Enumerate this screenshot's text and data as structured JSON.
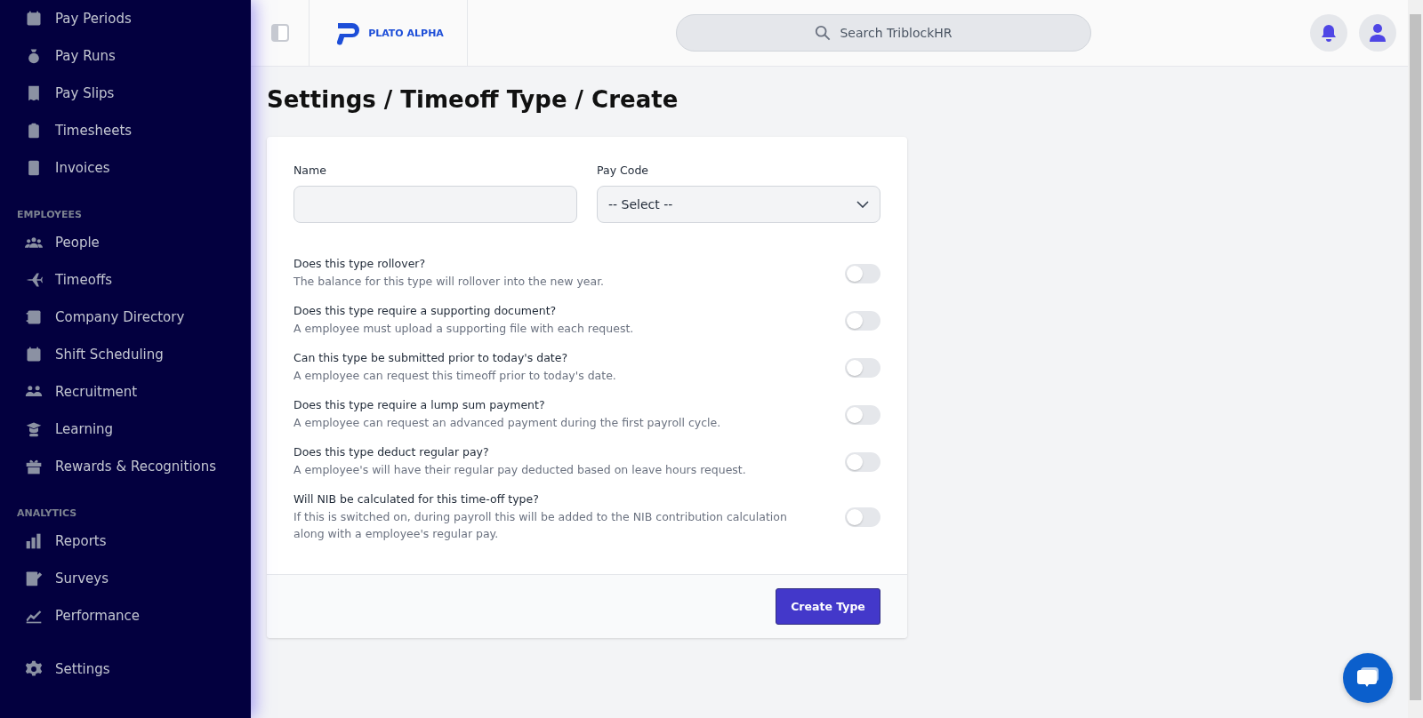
{
  "sidebar": {
    "groups": [
      {
        "items": [
          {
            "label": "Pay Periods"
          },
          {
            "label": "Pay Runs"
          },
          {
            "label": "Pay Slips"
          },
          {
            "label": "Timesheets"
          },
          {
            "label": "Invoices"
          }
        ]
      },
      {
        "heading": "EMPLOYEES",
        "items": [
          {
            "label": "People"
          },
          {
            "label": "Timeoffs"
          },
          {
            "label": "Company Directory"
          },
          {
            "label": "Shift Scheduling"
          },
          {
            "label": "Recruitment"
          },
          {
            "label": "Learning"
          },
          {
            "label": "Rewards & Recognitions"
          }
        ]
      },
      {
        "heading": "ANALYTICS",
        "items": [
          {
            "label": "Reports"
          },
          {
            "label": "Surveys"
          },
          {
            "label": "Performance"
          }
        ]
      }
    ],
    "footer_item": {
      "label": "Settings"
    }
  },
  "header": {
    "logo_text": "PLATO ALPHA",
    "search": {
      "placeholder": "Search TriblockHR"
    }
  },
  "page_title": "Settings / Timeoff Type / Create",
  "form": {
    "name_field": {
      "label": "Name"
    },
    "pay_code": {
      "label": "Pay Code",
      "value": "-- Select --"
    },
    "toggles": [
      {
        "question": "Does this type rollover?",
        "description": "The balance for this type will rollover into the new year.",
        "on": false
      },
      {
        "question": "Does this type require a supporting document?",
        "description": "A employee must upload a supporting file with each request.",
        "on": false
      },
      {
        "question": "Can this type be submitted prior to today's date?",
        "description": "A employee can request this timeoff prior to today's date.",
        "on": false
      },
      {
        "question": "Does this type require a lump sum payment?",
        "description": "A employee can request an advanced payment during the first payroll cycle.",
        "on": false
      },
      {
        "question": "Does this type deduct regular pay?",
        "description": "A employee's will have their regular pay deducted based on leave hours request.",
        "on": false
      },
      {
        "question": "Will NIB be calculated for this time-off type?",
        "description": "If this is switched on, during payroll this will be added to the NIB contribution calculation along with a employee's regular pay.",
        "on": false
      }
    ],
    "submit_button": "Create Type"
  }
}
